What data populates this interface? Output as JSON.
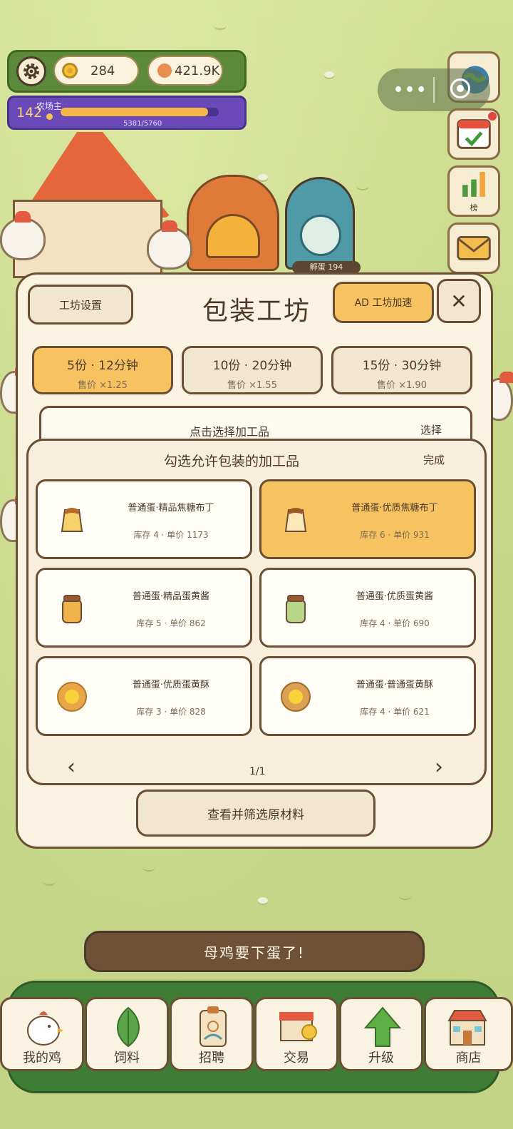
{
  "hud": {
    "coins": "284",
    "gems": "421.9K",
    "level": "142",
    "title": "农场主",
    "xp_text": "5381/5760",
    "xp_fraction": 0.934
  },
  "world": {
    "incubator_label": "孵蛋 194"
  },
  "right_buttons": {
    "rank_label": "榜"
  },
  "panel": {
    "settings_label": "工坊设置",
    "title": "包装工坊",
    "speedup_label": "AD 工坊加速",
    "close_symbol": "✕",
    "options": [
      {
        "line1": "5份 · 12分钟",
        "line2": "售价 ×1.25",
        "selected": true
      },
      {
        "line1": "10份 · 20分钟",
        "line2": "售价 ×1.55",
        "selected": false
      },
      {
        "line1": "15份 · 30分钟",
        "line2": "售价 ×1.90",
        "selected": false
      }
    ],
    "select_bar": {
      "label": "点击选择加工品",
      "action": "选择"
    },
    "popup": {
      "title": "勾选允许包装的加工品",
      "done": "完成",
      "items": [
        {
          "name": "普通蛋·精品焦糖布丁",
          "meta": "库存 4 · 单价 1173",
          "icon": "pudding-icon",
          "selected": false
        },
        {
          "name": "普通蛋·优质焦糖布丁",
          "meta": "库存 6 · 单价 931",
          "icon": "pudding-icon",
          "selected": true
        },
        {
          "name": "普通蛋·精品蛋黄酱",
          "meta": "库存 5 · 单价 862",
          "icon": "jar-icon",
          "selected": false
        },
        {
          "name": "普通蛋·优质蛋黄酱",
          "meta": "库存 4 · 单价 690",
          "icon": "jar-icon",
          "selected": false
        },
        {
          "name": "普通蛋·优质蛋黄酥",
          "meta": "库存 3 · 单价 828",
          "icon": "pastry-icon",
          "selected": false
        },
        {
          "name": "普通蛋·普通蛋黄酥",
          "meta": "库存 4 · 单价 621",
          "icon": "pastry-icon",
          "selected": false
        }
      ],
      "prev": "‹",
      "next": "›",
      "page": "1/1"
    },
    "view_button": "查看并筛选原材料"
  },
  "banner": "母鸡要下蛋了!",
  "nav": [
    {
      "label": "我的鸡",
      "icon": "chicken-icon"
    },
    {
      "label": "饲料",
      "icon": "leaf-icon"
    },
    {
      "label": "招聘",
      "icon": "badge-icon"
    },
    {
      "label": "交易",
      "icon": "market-icon"
    },
    {
      "label": "升级",
      "icon": "up-arrow-icon"
    },
    {
      "label": "商店",
      "icon": "shop-icon"
    }
  ],
  "colors": {
    "accent": "#f7c260",
    "border": "#6b4f34",
    "panel": "#fbf3e2",
    "grass": "#c7d78a",
    "nav_green": "#3e7d34",
    "xp_purple": "#6a4ab8"
  }
}
